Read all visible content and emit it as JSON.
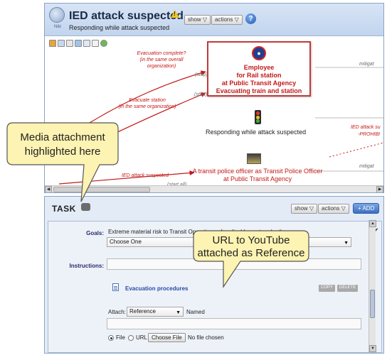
{
  "plan": {
    "title": "IED attack suspected",
    "subtitle": "Responding while attack suspected",
    "logo_text": "Niki",
    "show_label": "show ▽",
    "actions_label": "actions ▽",
    "help_label": "?"
  },
  "flow": {
    "node_employee": "Employee\nfor Rail station\nat Public Transit Agency\nEvacuating train and station",
    "event_label": "Responding while attack suspected",
    "node_officer": "A transit police officer as Transit Police Officer\nat Public Transit Agency",
    "label_evac_complete": "Evacuation complete?\n(in the same overall\norganization)",
    "label_evac_station": "Evacuate station\n(in the same organization)",
    "label_ied_suspected": "IED attack suspected",
    "tag_stop": "(stop)",
    "tag_start": "(start)",
    "tag_start_all": "(start all)",
    "side_mitigate_1": "mitigat",
    "side_mitigate_2": "mitigat",
    "side_ied": "IED attack su",
    "side_prohib": "-PROHIBI"
  },
  "task": {
    "title": "TASK",
    "show_label": "show ▽",
    "actions_label": "actions ▽",
    "add_label": "+ ADD",
    "goals_label": "Goals:",
    "goals_text": "Extreme material risk to Transit Operations of ... disablement or death",
    "goals_select": "Choose One",
    "instructions_label": "Instructions:",
    "attachment_link": "Evacuation procedures",
    "copy_label": "COPY",
    "delete_label": "DELETE",
    "attach_label": "Attach:",
    "attach_select": "Reference",
    "named_label": "Named",
    "file_option": "File",
    "url_option": "URL",
    "choose_file": "Choose File",
    "no_file": "No file chosen"
  },
  "callouts": {
    "media_line1": "Media attachment",
    "media_line2": "highlighted here",
    "url_line1": "URL to YouTube",
    "url_line2": "attached as Reference"
  },
  "colors": {
    "accent_red": "#c41818",
    "header_blue": "#c8d9f0",
    "callout_fill": "#fdf3b2"
  },
  "icons": [
    "warning-icon",
    "help-icon",
    "logo-icon",
    "traffic-light-icon",
    "photo-icon",
    "task-icon",
    "document-icon",
    "check-icon"
  ]
}
